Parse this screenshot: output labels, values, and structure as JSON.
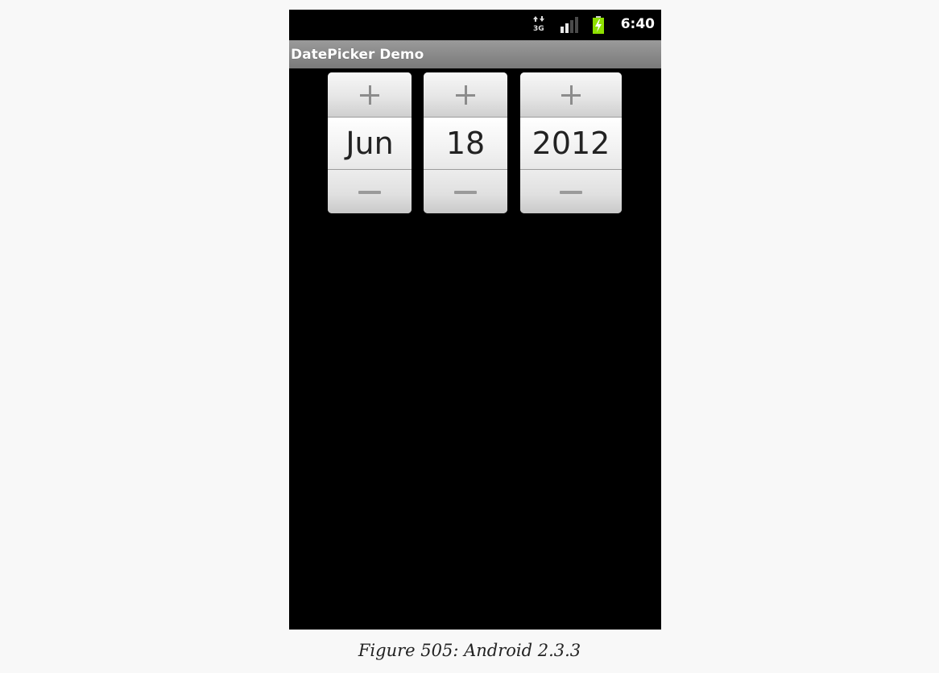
{
  "status_bar": {
    "time": "6:40",
    "network_icon": "3g-data-icon",
    "signal_icon": "signal-icon",
    "battery_icon": "battery-charging-icon",
    "battery_color": "#8ee000"
  },
  "app": {
    "title": "DatePicker Demo"
  },
  "date_picker": {
    "month": "Jun",
    "day": "18",
    "year": "2012",
    "increment_icon": "plus-icon",
    "decrement_icon": "minus-icon"
  },
  "caption": "Figure 505: Android 2.3.3"
}
